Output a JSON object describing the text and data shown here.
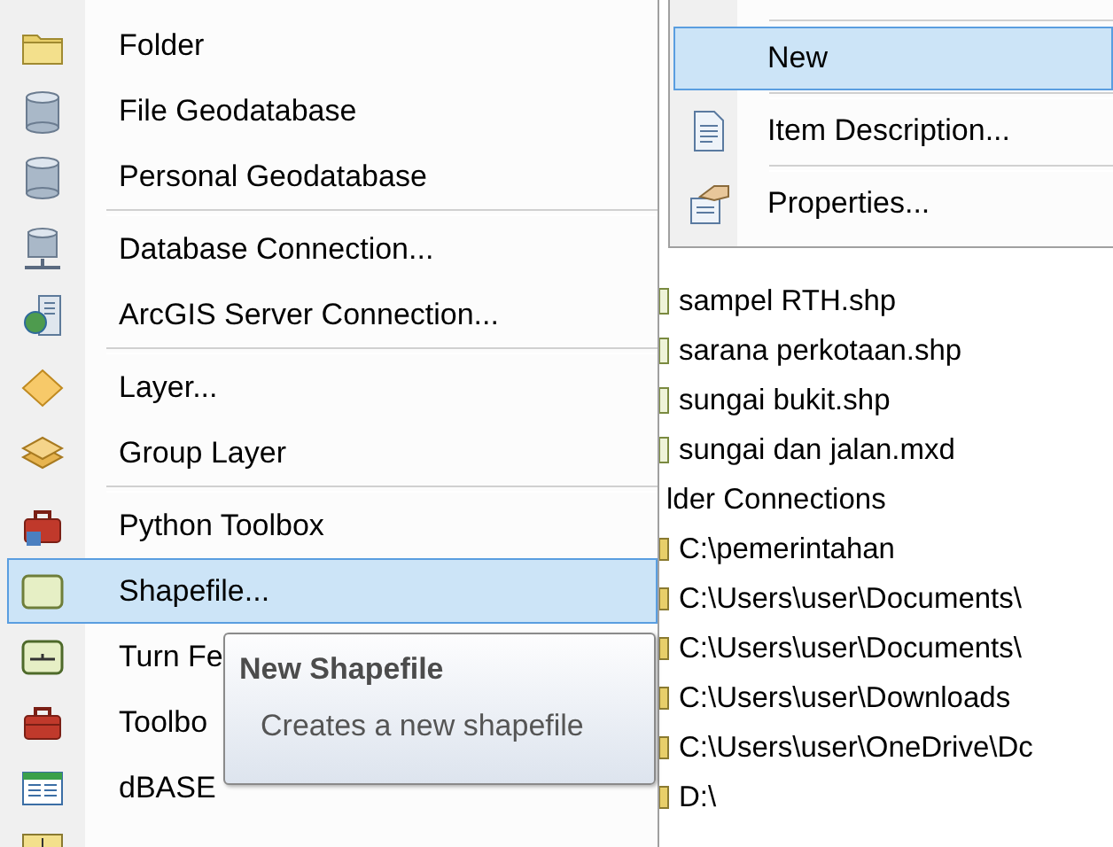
{
  "new_menu": {
    "items": [
      {
        "kind": "item",
        "label": "Folder",
        "selected": false
      },
      {
        "kind": "item",
        "label": "File Geodatabase",
        "selected": false
      },
      {
        "kind": "item",
        "label": "Personal Geodatabase",
        "selected": false
      },
      {
        "kind": "separator"
      },
      {
        "kind": "item",
        "label": "Database Connection...",
        "selected": false
      },
      {
        "kind": "item",
        "label": "ArcGIS Server Connection...",
        "selected": false
      },
      {
        "kind": "separator"
      },
      {
        "kind": "item",
        "label": "Layer...",
        "selected": false
      },
      {
        "kind": "item",
        "label": "Group Layer",
        "selected": false
      },
      {
        "kind": "separator"
      },
      {
        "kind": "item",
        "label": "Python Toolbox",
        "selected": false
      },
      {
        "kind": "item",
        "label": "Shapefile...",
        "selected": true
      },
      {
        "kind": "item",
        "label": "Turn Fe",
        "selected": false
      },
      {
        "kind": "item",
        "label": "Toolbo",
        "selected": false
      },
      {
        "kind": "item",
        "label": "dBASE",
        "selected": false
      },
      {
        "kind": "item",
        "selected": false
      }
    ]
  },
  "tooltip": {
    "title": "New Shapefile",
    "description": "Creates a new shapefile"
  },
  "context_menu": {
    "items": [
      {
        "kind": "separator"
      },
      {
        "kind": "item",
        "label": "New",
        "selected": true
      },
      {
        "kind": "separator"
      },
      {
        "kind": "item",
        "label": "Item Description...",
        "selected": false
      },
      {
        "kind": "separator"
      },
      {
        "kind": "item",
        "label": "Properties...",
        "selected": false
      }
    ]
  },
  "catalog_tree": {
    "rows": [
      {
        "kind": "file",
        "label": "sampel RTH.shp"
      },
      {
        "kind": "file",
        "label": "sarana perkotaan.shp"
      },
      {
        "kind": "file",
        "label": "sungai bukit.shp"
      },
      {
        "kind": "file",
        "label": "sungai dan jalan.mxd"
      },
      {
        "kind": "header",
        "label": "lder Connections"
      },
      {
        "kind": "folder",
        "label": "C:\\pemerintahan"
      },
      {
        "kind": "folder",
        "label": "C:\\Users\\user\\Documents\\"
      },
      {
        "kind": "folder",
        "label": "C:\\Users\\user\\Documents\\"
      },
      {
        "kind": "folder",
        "label": "C:\\Users\\user\\Downloads"
      },
      {
        "kind": "folder",
        "label": "C:\\Users\\user\\OneDrive\\Dc"
      },
      {
        "kind": "folder",
        "label": "D:\\"
      }
    ]
  }
}
